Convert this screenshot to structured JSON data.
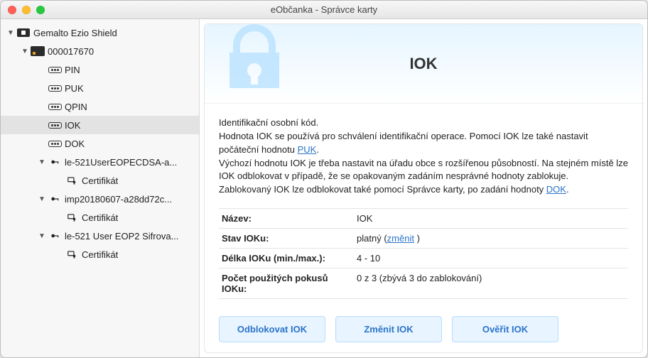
{
  "window": {
    "title": "eObčanka - Správce karty"
  },
  "tree": {
    "reader": "Gemalto Ezio Shield",
    "card": "000017670",
    "codes": {
      "pin": "PIN",
      "puk": "PUK",
      "qpin": "QPIN",
      "iok": "IOK",
      "dok": "DOK"
    },
    "containers": [
      {
        "name": "le-521UserEOPECDSA-a...",
        "cert": "Certifikát"
      },
      {
        "name": "imp20180607-a28dd72c...",
        "cert": "Certifikát"
      },
      {
        "name": "le-521 User EOP2 Sifrova...",
        "cert": "Certifikát"
      }
    ]
  },
  "panel": {
    "heading": "IOK",
    "description": {
      "p1": "Identifikační osobní kód.",
      "p2a": "Hodnota IOK se používá pro schválení identifikační operace. Pomocí IOK lze také nastavit počáteční hodnotu ",
      "p2_link": "PUK",
      "p2b": ".",
      "p3": "Výchozí hodnotu IOK je třeba nastavit na úřadu obce s rozšířenou působností. Na stejném místě lze IOK odblokovat v případě, že se opakovaným zadáním nesprávné hodnoty zablokuje.",
      "p4a": "Zablokovaný IOK lze odblokovat také pomocí Správce karty, po zadání hodnoty ",
      "p4_link": "DOK",
      "p4b": "."
    },
    "props": {
      "name_label": "Název:",
      "name_value": "IOK",
      "state_label": "Stav IOKu:",
      "state_value": "platný",
      "state_change": "změnit",
      "length_label": "Délka IOKu (min./max.):",
      "length_value": "4 - 10",
      "attempts_label": "Počet použitých pokusů IOKu:",
      "attempts_value": "0 z 3 (zbývá 3 do zablokování)"
    },
    "buttons": {
      "unblock": "Odblokovat IOK",
      "change": "Změnit IOK",
      "verify": "Ověřit IOK"
    }
  }
}
